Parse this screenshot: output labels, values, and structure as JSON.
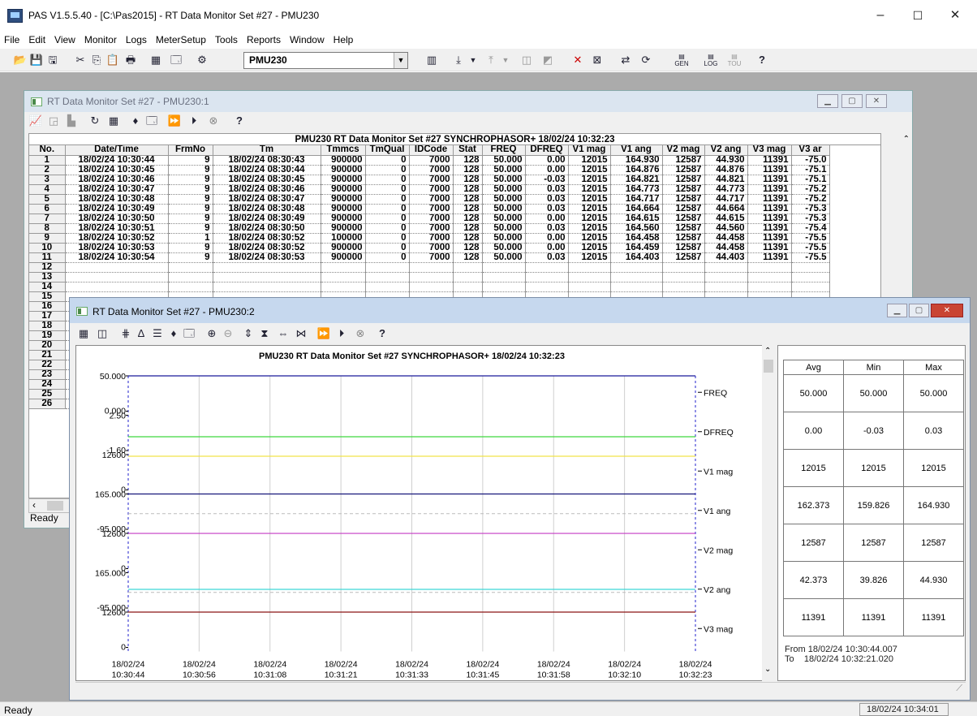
{
  "app": {
    "title": "PAS V1.5.5.40 - [C:\\Pas2015] - RT Data Monitor Set #27 - PMU230",
    "menu": [
      "File",
      "Edit",
      "View",
      "Monitor",
      "Logs",
      "MeterSetup",
      "Tools",
      "Reports",
      "Window",
      "Help"
    ],
    "device_combo": "PMU230",
    "status": "Ready",
    "status_time": "18/02/24 10:34:01",
    "window_controls": {
      "minimize": "–",
      "maximize": "☐",
      "close": "✕"
    }
  },
  "window1": {
    "title": "RT Data Monitor Set #27 - PMU230:1",
    "caption": "PMU230  RT Data Monitor  Set #27  SYNCHROPHASOR+  18/02/24  10:32:23",
    "columns": [
      "No.",
      "Date/Time",
      "FrmNo",
      "Tm",
      "Tmmcs",
      "TmQual",
      "IDCode",
      "Stat",
      "FREQ",
      "DFREQ",
      "V1 mag",
      "V1 ang",
      "V2 mag",
      "V2 ang",
      "V3 mag",
      "V3 ar"
    ],
    "rows": [
      [
        "1",
        "18/02/24 10:30:44",
        "9",
        "18/02/24 08:30:43",
        "900000",
        "0",
        "7000",
        "128",
        "50.000",
        "0.00",
        "12015",
        "164.930",
        "12587",
        "44.930",
        "11391",
        "-75.0"
      ],
      [
        "2",
        "18/02/24 10:30:45",
        "9",
        "18/02/24 08:30:44",
        "900000",
        "0",
        "7000",
        "128",
        "50.000",
        "0.00",
        "12015",
        "164.876",
        "12587",
        "44.876",
        "11391",
        "-75.1"
      ],
      [
        "3",
        "18/02/24 10:30:46",
        "9",
        "18/02/24 08:30:45",
        "900000",
        "0",
        "7000",
        "128",
        "50.000",
        "-0.03",
        "12015",
        "164.821",
        "12587",
        "44.821",
        "11391",
        "-75.1"
      ],
      [
        "4",
        "18/02/24 10:30:47",
        "9",
        "18/02/24 08:30:46",
        "900000",
        "0",
        "7000",
        "128",
        "50.000",
        "0.03",
        "12015",
        "164.773",
        "12587",
        "44.773",
        "11391",
        "-75.2"
      ],
      [
        "5",
        "18/02/24 10:30:48",
        "9",
        "18/02/24 08:30:47",
        "900000",
        "0",
        "7000",
        "128",
        "50.000",
        "0.03",
        "12015",
        "164.717",
        "12587",
        "44.717",
        "11391",
        "-75.2"
      ],
      [
        "6",
        "18/02/24 10:30:49",
        "9",
        "18/02/24 08:30:48",
        "900000",
        "0",
        "7000",
        "128",
        "50.000",
        "0.03",
        "12015",
        "164.664",
        "12587",
        "44.664",
        "11391",
        "-75.3"
      ],
      [
        "7",
        "18/02/24 10:30:50",
        "9",
        "18/02/24 08:30:49",
        "900000",
        "0",
        "7000",
        "128",
        "50.000",
        "0.00",
        "12015",
        "164.615",
        "12587",
        "44.615",
        "11391",
        "-75.3"
      ],
      [
        "8",
        "18/02/24 10:30:51",
        "9",
        "18/02/24 08:30:50",
        "900000",
        "0",
        "7000",
        "128",
        "50.000",
        "0.03",
        "12015",
        "164.560",
        "12587",
        "44.560",
        "11391",
        "-75.4"
      ],
      [
        "9",
        "18/02/24 10:30:52",
        "1",
        "18/02/24 08:30:52",
        "100000",
        "0",
        "7000",
        "128",
        "50.000",
        "0.00",
        "12015",
        "164.458",
        "12587",
        "44.458",
        "11391",
        "-75.5"
      ],
      [
        "10",
        "18/02/24 10:30:53",
        "9",
        "18/02/24 08:30:52",
        "900000",
        "0",
        "7000",
        "128",
        "50.000",
        "0.00",
        "12015",
        "164.459",
        "12587",
        "44.458",
        "11391",
        "-75.5"
      ],
      [
        "11",
        "18/02/24 10:30:54",
        "9",
        "18/02/24 08:30:53",
        "900000",
        "0",
        "7000",
        "128",
        "50.000",
        "0.03",
        "12015",
        "164.403",
        "12587",
        "44.403",
        "11391",
        "-75.5"
      ]
    ],
    "row_numbers_more": [
      "12",
      "13",
      "14",
      "15",
      "16",
      "17",
      "18",
      "19",
      "20",
      "21",
      "22",
      "23",
      "24",
      "25",
      "26"
    ],
    "status": "Ready"
  },
  "window2": {
    "title": "RT Data Monitor Set #27 - PMU230:2",
    "stats_headers": [
      "Avg",
      "Min",
      "Max"
    ],
    "stats_rows": [
      [
        "50.000",
        "50.000",
        "50.000"
      ],
      [
        "0.00",
        "-0.03",
        "0.03"
      ],
      [
        "12015",
        "12015",
        "12015"
      ],
      [
        "162.373",
        "159.826",
        "164.930"
      ],
      [
        "12587",
        "12587",
        "12587"
      ],
      [
        "42.373",
        "39.826",
        "44.930"
      ],
      [
        "11391",
        "11391",
        "11391"
      ]
    ],
    "from_label": "From 18/02/24 10:30:44.007",
    "to_label": "To    18/02/24 10:32:21.020"
  },
  "chart_data": {
    "type": "line",
    "title": "PMU230  RT Data Monitor  Set #27  SYNCHROPHASOR+  18/02/24  10:32:23",
    "x_labels": [
      [
        "18/02/24",
        "10:30:44"
      ],
      [
        "18/02/24",
        "10:30:56"
      ],
      [
        "18/02/24",
        "10:31:08"
      ],
      [
        "18/02/24",
        "10:31:21"
      ],
      [
        "18/02/24",
        "10:31:33"
      ],
      [
        "18/02/24",
        "10:31:45"
      ],
      [
        "18/02/24",
        "10:31:58"
      ],
      [
        "18/02/24",
        "10:32:10"
      ],
      [
        "18/02/24",
        "10:32:23"
      ]
    ],
    "grid": true,
    "bands": [
      {
        "name": "FREQ",
        "ymax_label": "50.000",
        "ymin_label": "0.000",
        "ymax": 50,
        "ymin": 0,
        "value": 50.0,
        "color": "#1b1b9a",
        "dashed_ref": false
      },
      {
        "name": "DFREQ",
        "ymax_label": "2.50",
        "ymin_label": "-1.60",
        "ymax": 2.5,
        "ymin": -1.6,
        "value": 0.0,
        "color": "#3fd83f",
        "dashed_ref": false
      },
      {
        "name": "V1 mag",
        "ymax_label": "12600",
        "ymin_label": "0",
        "ymax": 12600,
        "ymin": 0,
        "value": 12015,
        "color": "#f0e34a",
        "dashed_ref": false
      },
      {
        "name": "V1 ang",
        "ymax_label": "165.000",
        "ymin_label": "-95.000",
        "ymax": 165,
        "ymin": -95,
        "value": 165,
        "color": "#16167a",
        "dashed_ref": true
      },
      {
        "name": "V2 mag",
        "ymax_label": "12600",
        "ymin_label": "0",
        "ymax": 12600,
        "ymin": 0,
        "value": 12587,
        "color": "#c43bc4",
        "dashed_ref": false
      },
      {
        "name": "V2 ang",
        "ymax_label": "165.000",
        "ymin_label": "-95.000",
        "ymax": 165,
        "ymin": -95,
        "value": 42.373,
        "color": "#3fd6d6",
        "dashed_ref": true
      },
      {
        "name": "V3 mag",
        "ymax_label": "12600",
        "ymin_label": "0",
        "ymax": 12600,
        "ymin": 0,
        "value": 12600,
        "color": "#8b1414",
        "dashed_ref": false
      }
    ]
  }
}
